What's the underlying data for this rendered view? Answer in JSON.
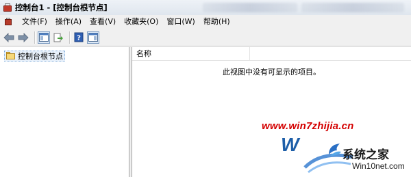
{
  "window": {
    "title": "控制台1 - [控制台根节点]"
  },
  "menu": {
    "items": [
      "文件(F)",
      "操作(A)",
      "查看(V)",
      "收藏夹(O)",
      "窗口(W)",
      "帮助(H)"
    ]
  },
  "toolbar": {
    "icons": [
      "back-arrow-icon",
      "forward-arrow-icon",
      "show-hide-console-tree-icon",
      "export-list-icon",
      "help-icon",
      "show-hide-action-pane-icon"
    ]
  },
  "tree": {
    "root_label": "控制台根节点"
  },
  "list": {
    "column_name": "名称",
    "empty_message": "此视图中没有可显示的项目。"
  },
  "watermark": {
    "url": "www.win7zhijia.cn",
    "brand": "系统之家",
    "site": "Win10net.com"
  },
  "colors": {
    "watermark_red": "#d40000",
    "logo_blue": "#1d5ea8",
    "selection_bg": "#e8f1fb"
  }
}
